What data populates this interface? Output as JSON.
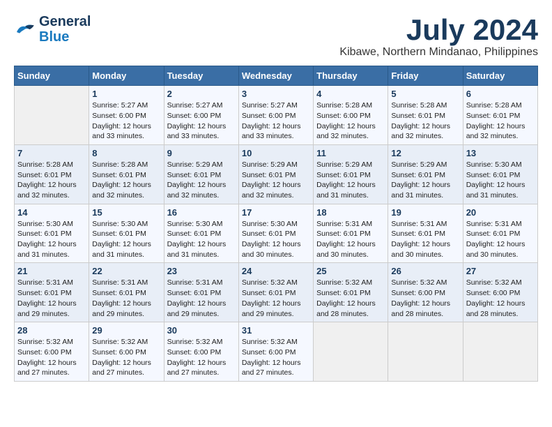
{
  "logo": {
    "general": "General",
    "blue": "Blue"
  },
  "title": {
    "month_year": "July 2024",
    "location": "Kibawe, Northern Mindanao, Philippines"
  },
  "days_of_week": [
    "Sunday",
    "Monday",
    "Tuesday",
    "Wednesday",
    "Thursday",
    "Friday",
    "Saturday"
  ],
  "weeks": [
    [
      {
        "day": "",
        "sunrise": "",
        "sunset": "",
        "daylight": "",
        "empty": true
      },
      {
        "day": "1",
        "sunrise": "Sunrise: 5:27 AM",
        "sunset": "Sunset: 6:00 PM",
        "daylight": "Daylight: 12 hours and 33 minutes."
      },
      {
        "day": "2",
        "sunrise": "Sunrise: 5:27 AM",
        "sunset": "Sunset: 6:00 PM",
        "daylight": "Daylight: 12 hours and 33 minutes."
      },
      {
        "day": "3",
        "sunrise": "Sunrise: 5:27 AM",
        "sunset": "Sunset: 6:00 PM",
        "daylight": "Daylight: 12 hours and 33 minutes."
      },
      {
        "day": "4",
        "sunrise": "Sunrise: 5:28 AM",
        "sunset": "Sunset: 6:00 PM",
        "daylight": "Daylight: 12 hours and 32 minutes."
      },
      {
        "day": "5",
        "sunrise": "Sunrise: 5:28 AM",
        "sunset": "Sunset: 6:01 PM",
        "daylight": "Daylight: 12 hours and 32 minutes."
      },
      {
        "day": "6",
        "sunrise": "Sunrise: 5:28 AM",
        "sunset": "Sunset: 6:01 PM",
        "daylight": "Daylight: 12 hours and 32 minutes."
      }
    ],
    [
      {
        "day": "7",
        "sunrise": "Sunrise: 5:28 AM",
        "sunset": "Sunset: 6:01 PM",
        "daylight": "Daylight: 12 hours and 32 minutes."
      },
      {
        "day": "8",
        "sunrise": "Sunrise: 5:28 AM",
        "sunset": "Sunset: 6:01 PM",
        "daylight": "Daylight: 12 hours and 32 minutes."
      },
      {
        "day": "9",
        "sunrise": "Sunrise: 5:29 AM",
        "sunset": "Sunset: 6:01 PM",
        "daylight": "Daylight: 12 hours and 32 minutes."
      },
      {
        "day": "10",
        "sunrise": "Sunrise: 5:29 AM",
        "sunset": "Sunset: 6:01 PM",
        "daylight": "Daylight: 12 hours and 32 minutes."
      },
      {
        "day": "11",
        "sunrise": "Sunrise: 5:29 AM",
        "sunset": "Sunset: 6:01 PM",
        "daylight": "Daylight: 12 hours and 31 minutes."
      },
      {
        "day": "12",
        "sunrise": "Sunrise: 5:29 AM",
        "sunset": "Sunset: 6:01 PM",
        "daylight": "Daylight: 12 hours and 31 minutes."
      },
      {
        "day": "13",
        "sunrise": "Sunrise: 5:30 AM",
        "sunset": "Sunset: 6:01 PM",
        "daylight": "Daylight: 12 hours and 31 minutes."
      }
    ],
    [
      {
        "day": "14",
        "sunrise": "Sunrise: 5:30 AM",
        "sunset": "Sunset: 6:01 PM",
        "daylight": "Daylight: 12 hours and 31 minutes."
      },
      {
        "day": "15",
        "sunrise": "Sunrise: 5:30 AM",
        "sunset": "Sunset: 6:01 PM",
        "daylight": "Daylight: 12 hours and 31 minutes."
      },
      {
        "day": "16",
        "sunrise": "Sunrise: 5:30 AM",
        "sunset": "Sunset: 6:01 PM",
        "daylight": "Daylight: 12 hours and 31 minutes."
      },
      {
        "day": "17",
        "sunrise": "Sunrise: 5:30 AM",
        "sunset": "Sunset: 6:01 PM",
        "daylight": "Daylight: 12 hours and 30 minutes."
      },
      {
        "day": "18",
        "sunrise": "Sunrise: 5:31 AM",
        "sunset": "Sunset: 6:01 PM",
        "daylight": "Daylight: 12 hours and 30 minutes."
      },
      {
        "day": "19",
        "sunrise": "Sunrise: 5:31 AM",
        "sunset": "Sunset: 6:01 PM",
        "daylight": "Daylight: 12 hours and 30 minutes."
      },
      {
        "day": "20",
        "sunrise": "Sunrise: 5:31 AM",
        "sunset": "Sunset: 6:01 PM",
        "daylight": "Daylight: 12 hours and 30 minutes."
      }
    ],
    [
      {
        "day": "21",
        "sunrise": "Sunrise: 5:31 AM",
        "sunset": "Sunset: 6:01 PM",
        "daylight": "Daylight: 12 hours and 29 minutes."
      },
      {
        "day": "22",
        "sunrise": "Sunrise: 5:31 AM",
        "sunset": "Sunset: 6:01 PM",
        "daylight": "Daylight: 12 hours and 29 minutes."
      },
      {
        "day": "23",
        "sunrise": "Sunrise: 5:31 AM",
        "sunset": "Sunset: 6:01 PM",
        "daylight": "Daylight: 12 hours and 29 minutes."
      },
      {
        "day": "24",
        "sunrise": "Sunrise: 5:32 AM",
        "sunset": "Sunset: 6:01 PM",
        "daylight": "Daylight: 12 hours and 29 minutes."
      },
      {
        "day": "25",
        "sunrise": "Sunrise: 5:32 AM",
        "sunset": "Sunset: 6:01 PM",
        "daylight": "Daylight: 12 hours and 28 minutes."
      },
      {
        "day": "26",
        "sunrise": "Sunrise: 5:32 AM",
        "sunset": "Sunset: 6:00 PM",
        "daylight": "Daylight: 12 hours and 28 minutes."
      },
      {
        "day": "27",
        "sunrise": "Sunrise: 5:32 AM",
        "sunset": "Sunset: 6:00 PM",
        "daylight": "Daylight: 12 hours and 28 minutes."
      }
    ],
    [
      {
        "day": "28",
        "sunrise": "Sunrise: 5:32 AM",
        "sunset": "Sunset: 6:00 PM",
        "daylight": "Daylight: 12 hours and 27 minutes."
      },
      {
        "day": "29",
        "sunrise": "Sunrise: 5:32 AM",
        "sunset": "Sunset: 6:00 PM",
        "daylight": "Daylight: 12 hours and 27 minutes."
      },
      {
        "day": "30",
        "sunrise": "Sunrise: 5:32 AM",
        "sunset": "Sunset: 6:00 PM",
        "daylight": "Daylight: 12 hours and 27 minutes."
      },
      {
        "day": "31",
        "sunrise": "Sunrise: 5:32 AM",
        "sunset": "Sunset: 6:00 PM",
        "daylight": "Daylight: 12 hours and 27 minutes."
      },
      {
        "day": "",
        "sunrise": "",
        "sunset": "",
        "daylight": "",
        "empty": true
      },
      {
        "day": "",
        "sunrise": "",
        "sunset": "",
        "daylight": "",
        "empty": true
      },
      {
        "day": "",
        "sunrise": "",
        "sunset": "",
        "daylight": "",
        "empty": true
      }
    ]
  ]
}
